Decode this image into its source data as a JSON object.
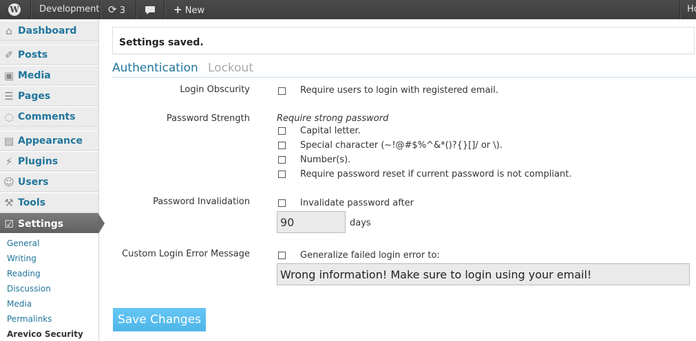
{
  "admin_bar": {
    "site_name": "Development",
    "updates_count": "3",
    "new_label": "New",
    "account_partial": "Ho"
  },
  "sidebar": {
    "menu": [
      {
        "label": "Dashboard",
        "icon": "dashboard-icon"
      },
      {
        "label": "Posts",
        "icon": "pushpin-icon"
      },
      {
        "label": "Media",
        "icon": "media-icon"
      },
      {
        "label": "Pages",
        "icon": "pages-icon"
      },
      {
        "label": "Comments",
        "icon": "comment-bubble-icon"
      },
      {
        "label": "Appearance",
        "icon": "appearance-icon"
      },
      {
        "label": "Plugins",
        "icon": "plug-icon"
      },
      {
        "label": "Users",
        "icon": "users-icon"
      },
      {
        "label": "Tools",
        "icon": "tools-icon"
      },
      {
        "label": "Settings",
        "icon": "settings-icon",
        "current": true
      }
    ],
    "submenu": [
      "General",
      "Writing",
      "Reading",
      "Discussion",
      "Media",
      "Permalinks",
      "Arevico Security"
    ],
    "submenu_current": "Arevico Security"
  },
  "notice": {
    "text": "Settings saved."
  },
  "tabs": [
    {
      "label": "Authentication",
      "active": true
    },
    {
      "label": "Lockout",
      "active": false
    }
  ],
  "form": {
    "login_obscurity": {
      "label": "Login Obscurity",
      "option": "Require users to login with registered email."
    },
    "password_strength": {
      "label": "Password Strength",
      "heading": "Require strong password",
      "options": [
        "Capital letter.",
        "Special character (~!@#$%^&*()?{}[]/ or \\).",
        "Number(s).",
        "Require password reset if current password is not compliant."
      ]
    },
    "password_invalidation": {
      "label": "Password Invalidation",
      "option": "Invalidate password after",
      "days_value": "90",
      "days_unit": "days"
    },
    "custom_error": {
      "label": "Custom Login Error Message",
      "option": "Generalize failed login error to:",
      "message_value": "Wrong information! Make sure to login using your email!"
    }
  },
  "save_button": "Save Changes",
  "colors": {
    "link": "#21759b",
    "admin_bar": "#464646",
    "save_button": "#5bc0f0"
  }
}
